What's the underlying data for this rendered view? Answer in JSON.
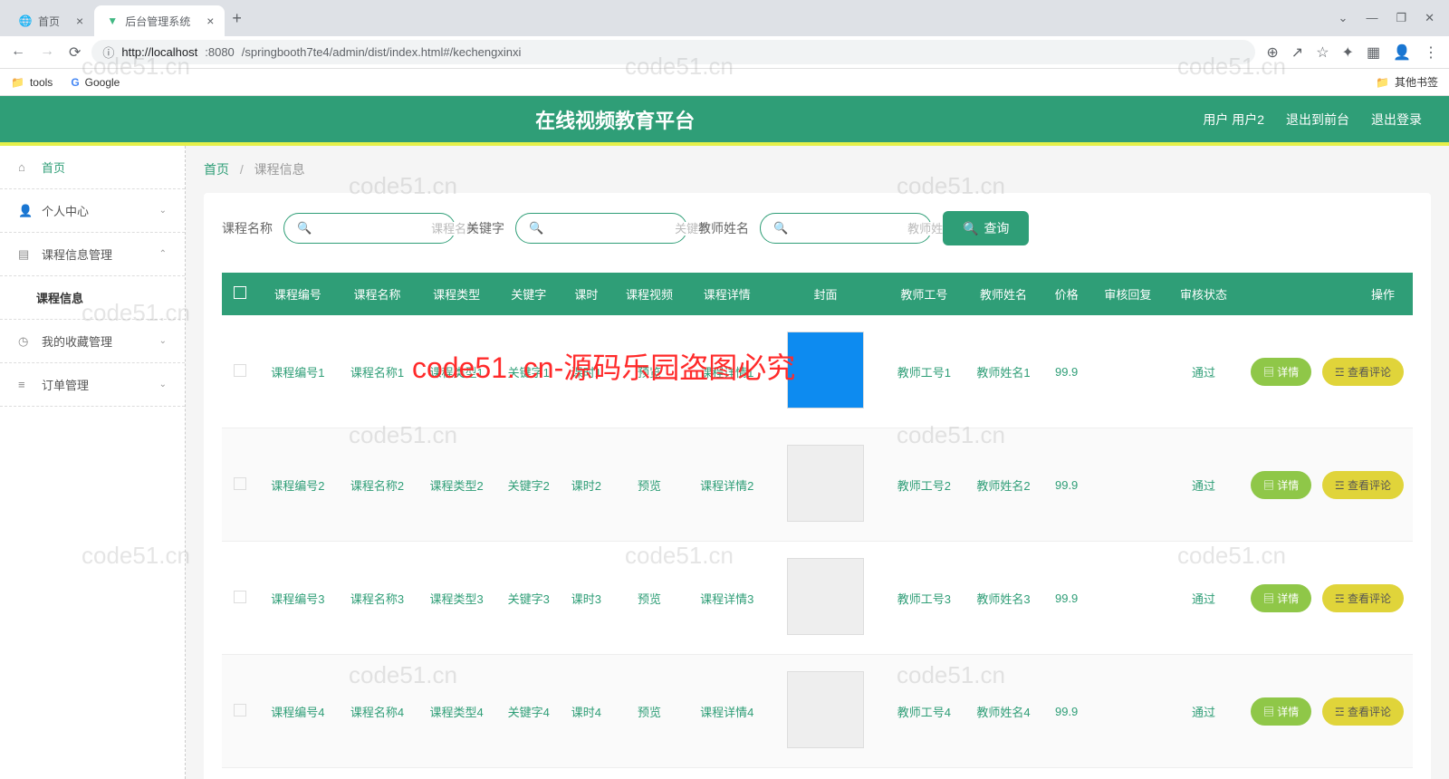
{
  "browser": {
    "tabs": [
      {
        "title": "首页",
        "active": false
      },
      {
        "title": "后台管理系统",
        "active": true
      }
    ],
    "url_host": "http://localhost",
    "url_port": ":8080",
    "url_path": "/springbooth7te4/admin/dist/index.html#/kechengxinxi",
    "bookmarks": {
      "tools": "tools",
      "google": "Google",
      "other": "其他书签"
    }
  },
  "header": {
    "title": "在线视频教育平台",
    "user_label": "用户 用户2",
    "exit_front": "退出到前台",
    "logout": "退出登录"
  },
  "sidebar": {
    "items": [
      {
        "label": "首页",
        "icon": "home",
        "active": true
      },
      {
        "label": "个人中心",
        "icon": "user",
        "chevron": "down"
      },
      {
        "label": "课程信息管理",
        "icon": "bars",
        "chevron": "up"
      },
      {
        "label": "课程信息",
        "sub": true
      },
      {
        "label": "我的收藏管理",
        "icon": "clock",
        "chevron": "down"
      },
      {
        "label": "订单管理",
        "icon": "list",
        "chevron": "down"
      }
    ]
  },
  "breadcrumb": {
    "home": "首页",
    "current": "课程信息"
  },
  "search": {
    "fields": [
      {
        "label": "课程名称",
        "placeholder": "课程名称"
      },
      {
        "label": "关键字",
        "placeholder": "关键字"
      },
      {
        "label": "教师姓名",
        "placeholder": "教师姓名"
      }
    ],
    "button": "查询"
  },
  "table": {
    "headers": [
      "课程编号",
      "课程名称",
      "课程类型",
      "关键字",
      "课时",
      "课程视频",
      "课程详情",
      "封面",
      "教师工号",
      "教师姓名",
      "价格",
      "审核回复",
      "审核状态",
      "操作"
    ],
    "rows": [
      {
        "num": "课程编号1",
        "name": "课程名称1",
        "type": "课程类型1",
        "kw": "关键字1",
        "hrs": "课时1",
        "vid": "预览",
        "detail": "课程详情1",
        "tid": "教师工号1",
        "tname": "教师姓名1",
        "price": "99.9",
        "reply": "",
        "status": "通过"
      },
      {
        "num": "课程编号2",
        "name": "课程名称2",
        "type": "课程类型2",
        "kw": "关键字2",
        "hrs": "课时2",
        "vid": "预览",
        "detail": "课程详情2",
        "tid": "教师工号2",
        "tname": "教师姓名2",
        "price": "99.9",
        "reply": "",
        "status": "通过"
      },
      {
        "num": "课程编号3",
        "name": "课程名称3",
        "type": "课程类型3",
        "kw": "关键字3",
        "hrs": "课时3",
        "vid": "预览",
        "detail": "课程详情3",
        "tid": "教师工号3",
        "tname": "教师姓名3",
        "price": "99.9",
        "reply": "",
        "status": "通过"
      },
      {
        "num": "课程编号4",
        "name": "课程名称4",
        "type": "课程类型4",
        "kw": "关键字4",
        "hrs": "课时4",
        "vid": "预览",
        "detail": "课程详情4",
        "tid": "教师工号4",
        "tname": "教师姓名4",
        "price": "99.9",
        "reply": "",
        "status": "通过"
      }
    ],
    "op_detail": "详情",
    "op_comment": "查看评论"
  },
  "watermark": {
    "grey": "code51.cn",
    "red": "code51. cn-源码乐园盗图必究"
  }
}
